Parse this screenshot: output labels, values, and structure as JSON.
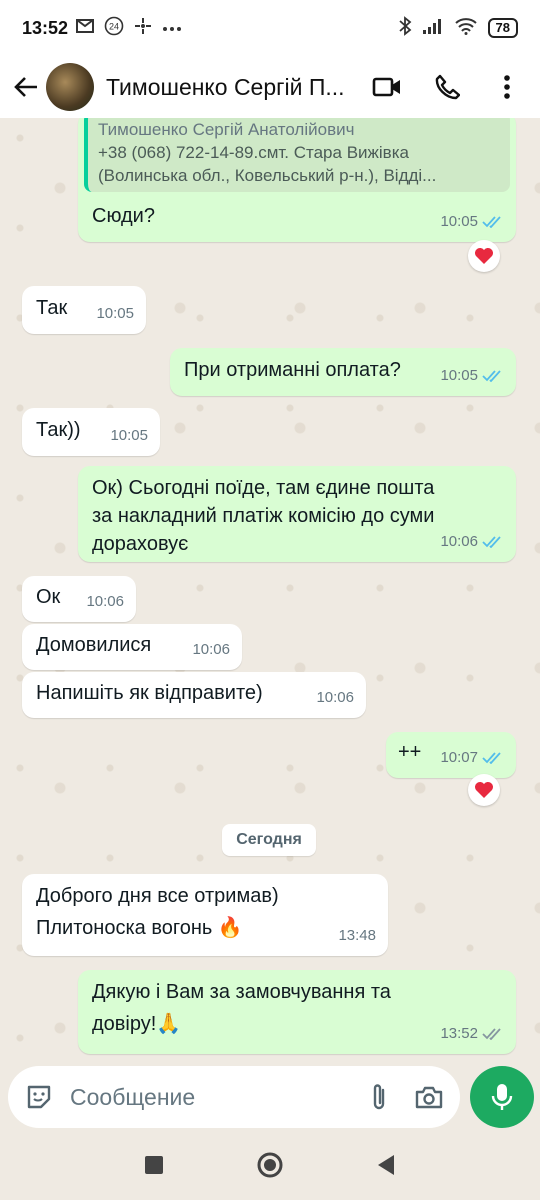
{
  "status_bar": {
    "time": "13:52",
    "icons": [
      "gmail-icon",
      "notification-24-icon",
      "fan-icon",
      "more-dots"
    ],
    "battery": "78"
  },
  "header": {
    "contact_name": "Тимошенко Сергій П...",
    "icons": [
      "back-arrow-icon",
      "video-call-icon",
      "phone-icon",
      "menu-icon"
    ]
  },
  "quote": {
    "name": "Тимошенко Сергій Анатолійович",
    "line1": "+38 (068) 722-14-89.смт. Стара Вижівка",
    "line2": "(Волинська обл., Ковельський р-н.), Відді..."
  },
  "messages": [
    {
      "id": "m1",
      "dir": "out",
      "text": "Сюди?",
      "time": "10:05",
      "read": true,
      "reaction": "heart"
    },
    {
      "id": "m2",
      "dir": "in",
      "text": "Так",
      "time": "10:05"
    },
    {
      "id": "m3",
      "dir": "out",
      "text": "При отриманні оплата?",
      "time": "10:05",
      "read": true
    },
    {
      "id": "m4",
      "dir": "in",
      "text": "Так))",
      "time": "10:05"
    },
    {
      "id": "m5",
      "dir": "out",
      "lines": [
        "Ок) Сьогодні поїде, там єдине пошта",
        "за накладний платіж комісію до суми",
        "дораховує"
      ],
      "time": "10:06",
      "read": true
    },
    {
      "id": "m6",
      "dir": "in",
      "text": "Ок",
      "time": "10:06"
    },
    {
      "id": "m7",
      "dir": "in",
      "text": "Домовилися",
      "time": "10:06"
    },
    {
      "id": "m8",
      "dir": "in",
      "text": "Напишіть як відправите)",
      "time": "10:06"
    },
    {
      "id": "m9",
      "dir": "out",
      "text": "++",
      "time": "10:07",
      "read": true,
      "reaction": "heart"
    },
    {
      "id": "m10",
      "dir": "in",
      "lines": [
        "Доброго дня все отримав)",
        "Плитоноска вогонь 🔥"
      ],
      "time": "13:48"
    },
    {
      "id": "m11",
      "dir": "out",
      "lines": [
        "Дякую і Вам за замовчування та",
        "довіру!🙏"
      ],
      "time": "13:52",
      "read": false
    }
  ],
  "date_divider": "Сегодня",
  "input": {
    "placeholder": "Сообщение"
  },
  "colors": {
    "incoming_bubble": "#ffffff",
    "outgoing_bubble": "#d9fdd3",
    "read_tick": "#53bdeb",
    "unread_tick": "#8696a0",
    "mic_button": "#1daa61",
    "chat_background": "#efeae2"
  }
}
